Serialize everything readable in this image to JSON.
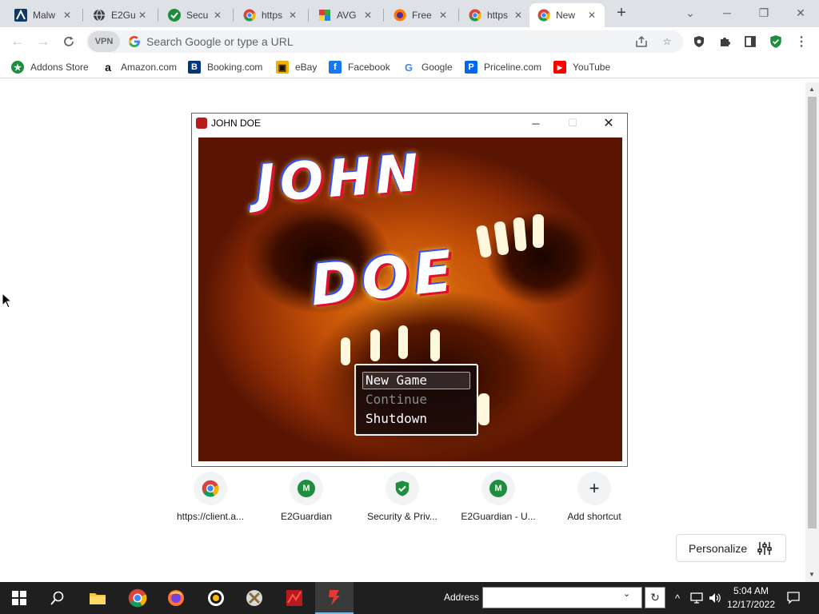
{
  "browser": {
    "tabs": [
      {
        "title": "Malw",
        "icon": "malwarebytes-icon",
        "active": false
      },
      {
        "title": "E2Gu",
        "icon": "globe-icon",
        "active": false
      },
      {
        "title": "Secu",
        "icon": "shield-check-icon",
        "active": false
      },
      {
        "title": "https",
        "icon": "chrome-icon",
        "active": false
      },
      {
        "title": "AVG",
        "icon": "avg-icon",
        "active": false
      },
      {
        "title": "Free",
        "icon": "avast-icon",
        "active": false
      },
      {
        "title": "https",
        "icon": "chrome-icon",
        "active": false
      },
      {
        "title": "New",
        "icon": "chrome-icon",
        "active": true
      }
    ],
    "omnibox": {
      "vpn_label": "VPN",
      "placeholder": "Search Google or type a URL"
    },
    "bookmarks": [
      {
        "label": "Addons Store",
        "icon": "addons-store-icon",
        "color": "#1e8e3e"
      },
      {
        "label": "Amazon.com",
        "icon": "amazon-icon",
        "color": "#222222"
      },
      {
        "label": "Booking.com",
        "icon": "booking-icon",
        "color": "#003580"
      },
      {
        "label": "eBay",
        "icon": "ebay-icon",
        "color": "#e53238"
      },
      {
        "label": "Facebook",
        "icon": "facebook-icon",
        "color": "#1877f2"
      },
      {
        "label": "Google",
        "icon": "google-icon",
        "color": "#4285f4"
      },
      {
        "label": "Priceline.com",
        "icon": "priceline-icon",
        "color": "#0068ef"
      },
      {
        "label": "YouTube",
        "icon": "youtube-icon",
        "color": "#ff0000"
      }
    ]
  },
  "newtab": {
    "shortcuts": [
      {
        "label": "https://client.a...",
        "icon": "chrome-icon"
      },
      {
        "label": "E2Guardian",
        "icon": "m-icon"
      },
      {
        "label": "Security & Priv...",
        "icon": "shield-check-icon"
      },
      {
        "label": "E2Guardian - U...",
        "icon": "m-icon"
      },
      {
        "label": "Add shortcut",
        "icon": "plus-icon"
      }
    ],
    "personalize_label": "Personalize"
  },
  "game_window": {
    "title": "JOHN DOE",
    "logo_line1": "JOHN",
    "logo_line2": "DOE",
    "menu": {
      "items": [
        {
          "label": "New Game",
          "enabled": true,
          "selected": true
        },
        {
          "label": "Continue",
          "enabled": false,
          "selected": false
        },
        {
          "label": "Shutdown",
          "enabled": true,
          "selected": false
        }
      ]
    }
  },
  "taskbar": {
    "address_label": "Address",
    "address_value": "",
    "time": "5:04 AM",
    "date": "12/17/2022",
    "pinned": [
      "start-icon",
      "search-icon",
      "file-explorer-icon",
      "chrome-icon",
      "firefox-icon",
      "chrome-alt-icon",
      "game-icon-1",
      "game-icon-2",
      "john-doe-icon"
    ]
  },
  "colors": {
    "accent_green": "#1e8e3e",
    "tab_bar": "#dee1e6",
    "taskbar": "#1f1f1f"
  }
}
